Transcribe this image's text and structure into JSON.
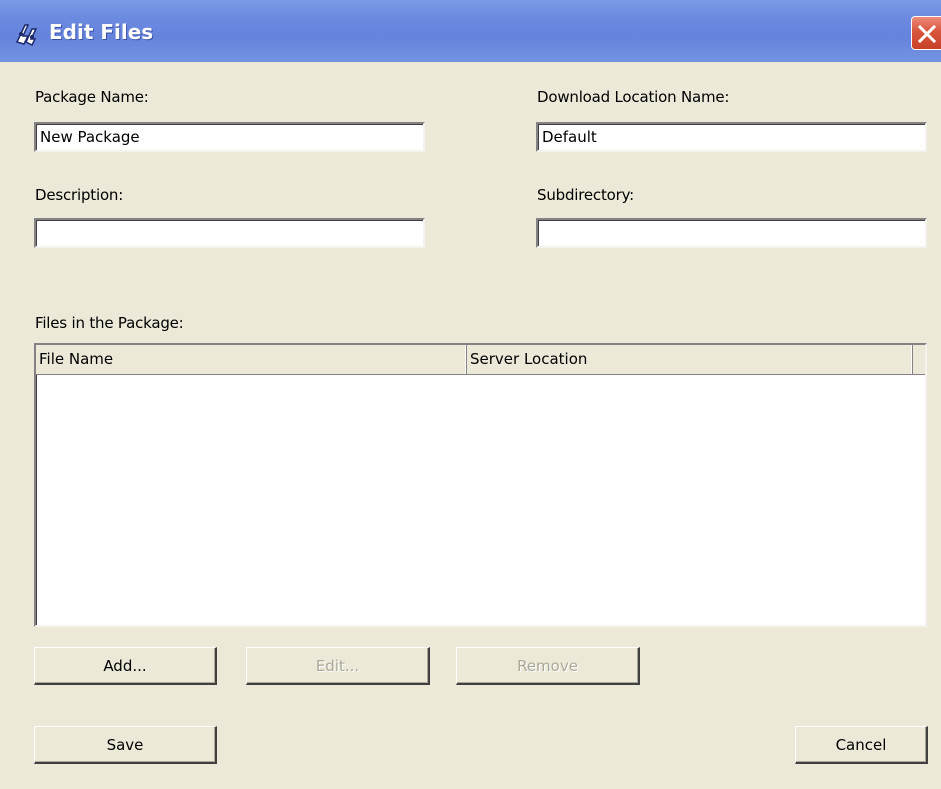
{
  "window": {
    "title": "Edit Files",
    "icon": "app-icon",
    "close_icon": "close-icon"
  },
  "form": {
    "package_name": {
      "label": "Package Name:",
      "value": "New Package"
    },
    "download_location_name": {
      "label": "Download Location Name:",
      "value": "Default"
    },
    "description": {
      "label": "Description:",
      "value": ""
    },
    "subdirectory": {
      "label": "Subdirectory:",
      "value": ""
    }
  },
  "files": {
    "label": "Files in the Package:",
    "columns": [
      "File Name",
      "Server Location"
    ],
    "rows": []
  },
  "buttons": {
    "add": "Add...",
    "edit": "Edit...",
    "remove": "Remove",
    "save": "Save",
    "cancel": "Cancel"
  },
  "colors": {
    "titlebar": "#6c8be0",
    "dialog_background": "#ece9d8",
    "close_button": "#d8563d",
    "disabled_text": "#aca899"
  }
}
